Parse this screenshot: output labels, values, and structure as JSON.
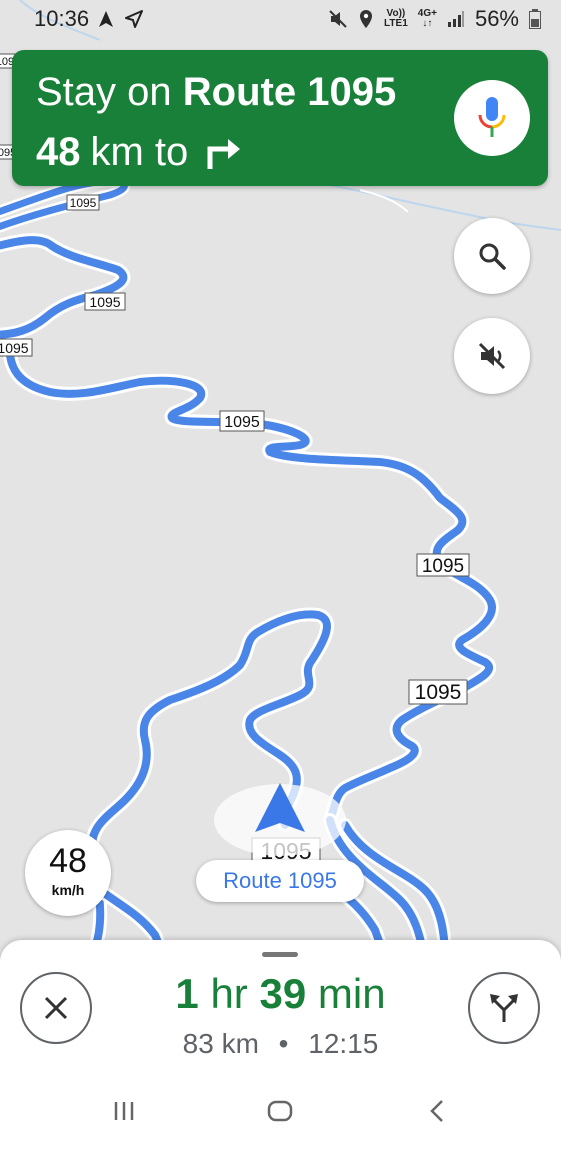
{
  "status_bar": {
    "time": "10:36",
    "carrier_top": "Vo))",
    "carrier_bottom": "LTE1",
    "network_top": "4G+",
    "network_bottom": "↓↑",
    "battery": "56%"
  },
  "banner": {
    "instruction_prefix": "Stay on ",
    "road": "Route 1095",
    "distance": "48",
    "distance_suffix": "km to",
    "next_turn_icon": "turn-right-icon",
    "color": "#188038"
  },
  "map": {
    "route_shields": [
      "1095",
      "1095",
      "1095",
      "1095",
      "1095",
      "1095",
      "1095",
      "1095",
      "1095",
      "1095"
    ],
    "current_road_label": "Route 1095",
    "route_color": "#4a86e8"
  },
  "speed": {
    "value": "48",
    "unit": "km/h"
  },
  "trip": {
    "hours": "1",
    "hours_label": "hr",
    "minutes": "39",
    "minutes_label": "min",
    "distance": "83 km",
    "separator": "•",
    "arrival": "12:15"
  }
}
